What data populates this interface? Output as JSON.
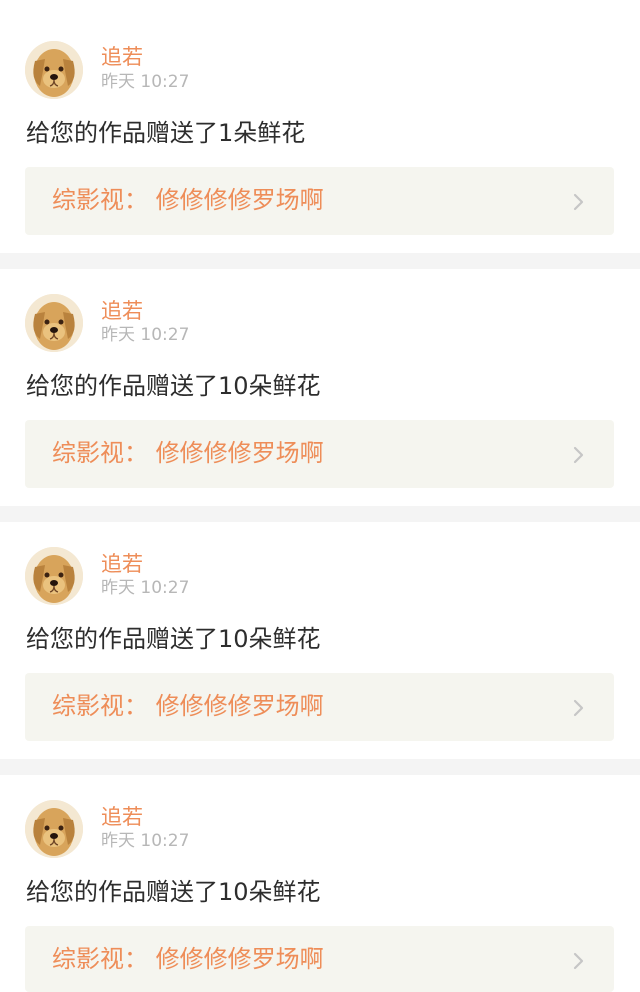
{
  "notifications": [
    {
      "username": "追若",
      "time": "昨天 10:27",
      "message": "给您的作品赠送了1朵鲜花",
      "work": "综影视：  修修修修罗场啊"
    },
    {
      "username": "追若",
      "time": "昨天 10:27",
      "message": "给您的作品赠送了10朵鲜花",
      "work": "综影视：  修修修修罗场啊"
    },
    {
      "username": "追若",
      "time": "昨天 10:27",
      "message": "给您的作品赠送了10朵鲜花",
      "work": "综影视：  修修修修罗场啊"
    },
    {
      "username": "追若",
      "time": "昨天 10:27",
      "message": "给您的作品赠送了10朵鲜花",
      "work": "综影视：  修修修修罗场啊"
    }
  ],
  "icons": {
    "avatar": "dog-avatar-icon",
    "chevron": "chevron-right-icon"
  },
  "colors": {
    "accent": "#ee8d58",
    "tab_indicator": "#e96fa0",
    "muted_text": "#b7b7b7",
    "body_text": "#2d2d2d",
    "link_background": "#f5f5ef",
    "separator": "#f4f4f4"
  }
}
